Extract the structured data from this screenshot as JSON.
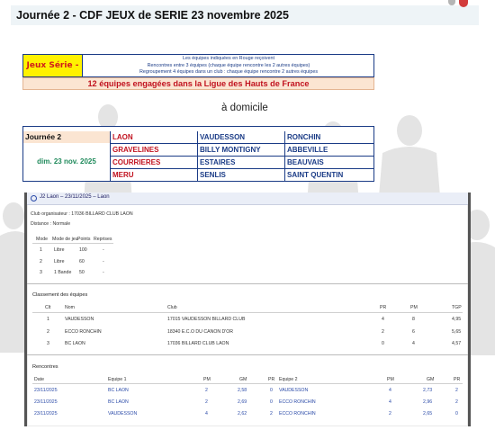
{
  "title": "Journée 2 - CDF JEUX de SERIE 23 novembre 2025",
  "info_box": {
    "category": "Jeux Série - F3",
    "lines": [
      "Les équipes indiquées en Rouge reçoivent",
      "Rencontres entre 3 équipes (chaque équipe rencontre les 2 autres équipes)",
      "Regroupement 4 équipes dans un club : chaque équipe rencontre 2 autres équipes"
    ]
  },
  "banner": "12 équipes engagées dans la Ligue des Hauts de France",
  "home_label": "à domicile",
  "schedule": {
    "round": "Journée 2",
    "date": "dim. 23 nov. 2025",
    "rows": [
      [
        "LAON",
        "VAUDESSON",
        "RONCHIN"
      ],
      [
        "GRAVELINES",
        "BILLY MONTIGNY",
        "ABBEVILLE"
      ],
      [
        "COURRIERES",
        "ESTAIRES",
        "BEAUVAIS"
      ],
      [
        "MERU",
        "SENLIS",
        "SAINT QUENTIN"
      ]
    ]
  },
  "screenshot": {
    "header": "J2 Laon – 23/11/2025 – Laon",
    "club_line": "Club organisateur : 17036 BILLARD CLUB LAON",
    "distance_line": "Distance : Normale",
    "modes_headers": [
      "Mode",
      "Mode de jeu",
      "Points",
      "Reprises"
    ],
    "modes": [
      [
        "1",
        "Libre",
        "100",
        "-"
      ],
      [
        "2",
        "Libre",
        "60",
        "-"
      ],
      [
        "3",
        "1 Bande",
        "50",
        "-"
      ]
    ],
    "ranking_title": "Classement des équipes",
    "ranking_headers": [
      "Clt",
      "Nom",
      "Club",
      "PR",
      "PM",
      "TGP"
    ],
    "ranking": [
      [
        "1",
        "VAUDESSON",
        "17015 VAUDESSON BILLARD CLUB",
        "4",
        "8",
        "4,95"
      ],
      [
        "2",
        "ECCO RONCHIN",
        "18340 E.C.O DU CANON D'OR",
        "2",
        "6",
        "5,65"
      ],
      [
        "3",
        "BC LAON",
        "17036 BILLARD CLUB LAON",
        "0",
        "4",
        "4,57"
      ]
    ],
    "matches_title": "Rencontres",
    "match_headers": [
      "Date",
      "Equipe 1",
      "PM",
      "GM",
      "PR",
      "Equipe 2",
      "PM",
      "GM",
      "PR"
    ],
    "matches": [
      [
        "23/11/2025",
        "BC LAON",
        "2",
        "2,58",
        "0",
        "VAUDESSON",
        "4",
        "2,73",
        "2"
      ],
      [
        "23/11/2025",
        "BC LAON",
        "2",
        "2,69",
        "0",
        "ECCO RONCHIN",
        "4",
        "2,96",
        "2"
      ],
      [
        "23/11/2025",
        "VAUDESSON",
        "4",
        "2,62",
        "2",
        "ECCO RONCHIN",
        "2",
        "2,65",
        "0"
      ]
    ]
  },
  "colors": {
    "home_team": "#c1121f",
    "away_team": "#1a3b86",
    "category_bg": "#fff200",
    "banner_bg": "#fbe5d2"
  }
}
